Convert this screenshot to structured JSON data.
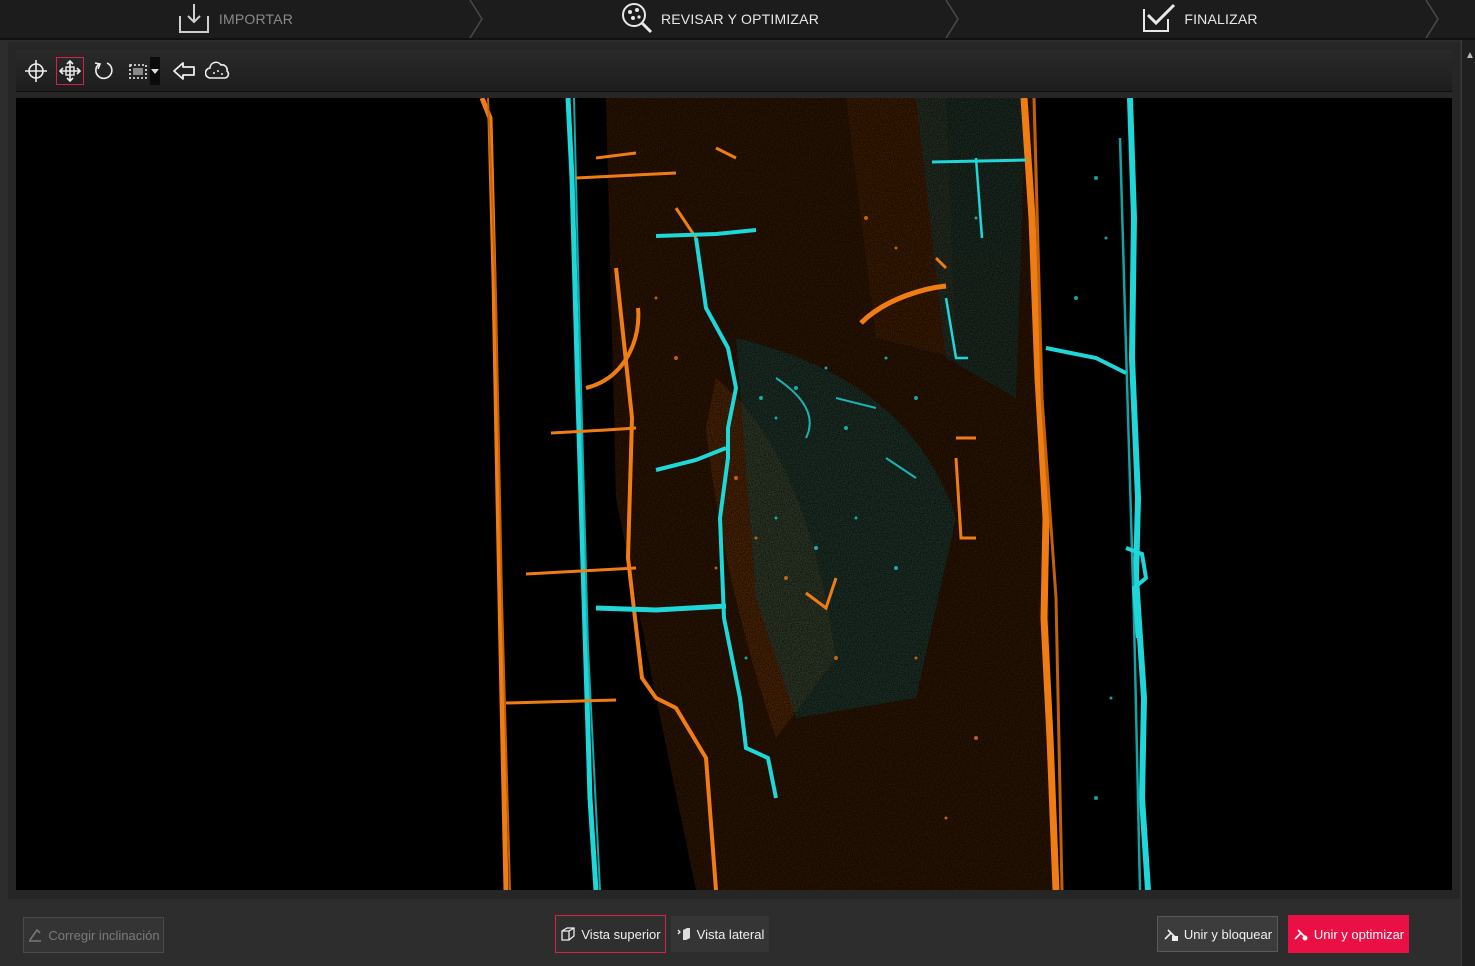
{
  "steps": [
    {
      "label": "IMPORTAR",
      "state": "disabled",
      "icon": "import-icon"
    },
    {
      "label": "REVISAR Y OPTIMIZAR",
      "state": "current",
      "icon": "review-optimize-icon"
    },
    {
      "label": "FINALIZAR",
      "state": "enabled",
      "icon": "finalize-check-icon"
    }
  ],
  "toolbar": {
    "tools": [
      {
        "name": "orbit-tool",
        "icon": "orbit-icon",
        "active": false
      },
      {
        "name": "pan-tool",
        "icon": "pan-move-icon",
        "active": true
      },
      {
        "name": "rotate-tool",
        "icon": "rotate-icon",
        "active": false
      },
      {
        "name": "selection-tool",
        "icon": "selection-rectangle-icon",
        "active": false
      },
      {
        "name": "undo-tool",
        "icon": "back-arrow-icon",
        "active": false
      },
      {
        "name": "cloud-tool",
        "icon": "cloud-icon",
        "active": false
      }
    ]
  },
  "colors": {
    "scan_a": "#f07d14",
    "scan_b": "#1fd6d9",
    "accent": "#ea1045",
    "canvas_bg": "#000000"
  },
  "bottom": {
    "corregir": "Corregir inclinación",
    "vista_superior": "Vista superior",
    "vista_lateral": "Vista lateral",
    "unir_bloquear": "Unir y bloquear",
    "unir_optimizar": "Unir y optimizar"
  }
}
